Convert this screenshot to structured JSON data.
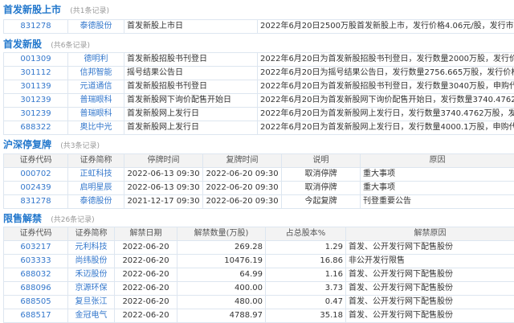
{
  "ipo": {
    "title": "首发新股上市",
    "count": "(共1条记录)",
    "rows": [
      [
        "831278",
        "泰德股份",
        "首发新股上市日",
        "2022年6月20日2500万股首发新股上市，发行价格4.06元/股，发行市盈率1"
      ]
    ]
  },
  "new_issue": {
    "title": "首发新股",
    "count": "(共6条记录)",
    "rows": [
      [
        "001309",
        "德明利",
        "首发新股招股书刊登日",
        "2022年6月20日为首发新股招股书刊登日，发行数量2000万股，发行价格2"
      ],
      [
        "301112",
        "信邦智能",
        "摇号结果公告日",
        "2022年6月20日为摇号结果公告日，发行数量2756.665万股，发行价格27.5"
      ],
      [
        "301139",
        "元道通信",
        "首发新股招股书刊登日",
        "2022年6月20日为首发新股招股书刊登日，发行数量3040万股，申购代码3"
      ],
      [
        "301239",
        "普瑞眼科",
        "首发新股网下询价配售开始日",
        "2022年6月20日为首发新股网下询价配售开始日，发行数量3740.4762万股"
      ],
      [
        "301239",
        "普瑞眼科",
        "首发新股网上发行日",
        "2022年6月20日为首发新股网上发行日，发行数量3740.4762万股，发行价"
      ],
      [
        "688322",
        "奥比中光",
        "首发新股网上发行日",
        "2022年6月20日为首发新股网上发行日，发行数量4000.1万股，申购代码"
      ]
    ]
  },
  "suspension": {
    "title": "沪深停复牌",
    "count": "(共3条记录)",
    "headers": [
      "证券代码",
      "证券简称",
      "停牌时间",
      "复牌时间",
      "说明",
      "原因"
    ],
    "rows": [
      [
        "000702",
        "正虹科技",
        "2022-06-13 09:30",
        "2022-06-20 09:30",
        "取消停牌",
        "重大事项"
      ],
      [
        "002439",
        "启明星辰",
        "2022-06-13 09:30",
        "2022-06-20 09:30",
        "取消停牌",
        "重大事项"
      ],
      [
        "831278",
        "泰德股份",
        "2021-12-17 09:30",
        "2022-06-20 09:30",
        "今起复牌",
        "刊登重要公告"
      ]
    ]
  },
  "unlock": {
    "title": "限售解禁",
    "count": "(共26条记录)",
    "headers": [
      "证券代码",
      "证券简称",
      "解禁日期",
      "解禁数量(万股)",
      "占总股本%",
      "解禁原因"
    ],
    "rows": [
      [
        "603217",
        "元利科技",
        "2022-06-20",
        "269.28",
        "1.29",
        "首发、公开发行网下配售股份"
      ],
      [
        "603333",
        "尚纬股份",
        "2022-06-20",
        "10476.19",
        "16.86",
        "非公开发行限售"
      ],
      [
        "688032",
        "禾迈股份",
        "2022-06-20",
        "64.99",
        "1.16",
        "首发、公开发行网下配售股份"
      ],
      [
        "688096",
        "京源环保",
        "2022-06-20",
        "400.00",
        "3.73",
        "首发、公开发行网下配售股份"
      ],
      [
        "688505",
        "复旦张江",
        "2022-06-20",
        "480.00",
        "0.47",
        "首发、公开发行网下配售股份"
      ],
      [
        "688517",
        "金冠电气",
        "2022-06-20",
        "4788.97",
        "35.18",
        "首发、公开发行网下配售股份"
      ]
    ]
  }
}
